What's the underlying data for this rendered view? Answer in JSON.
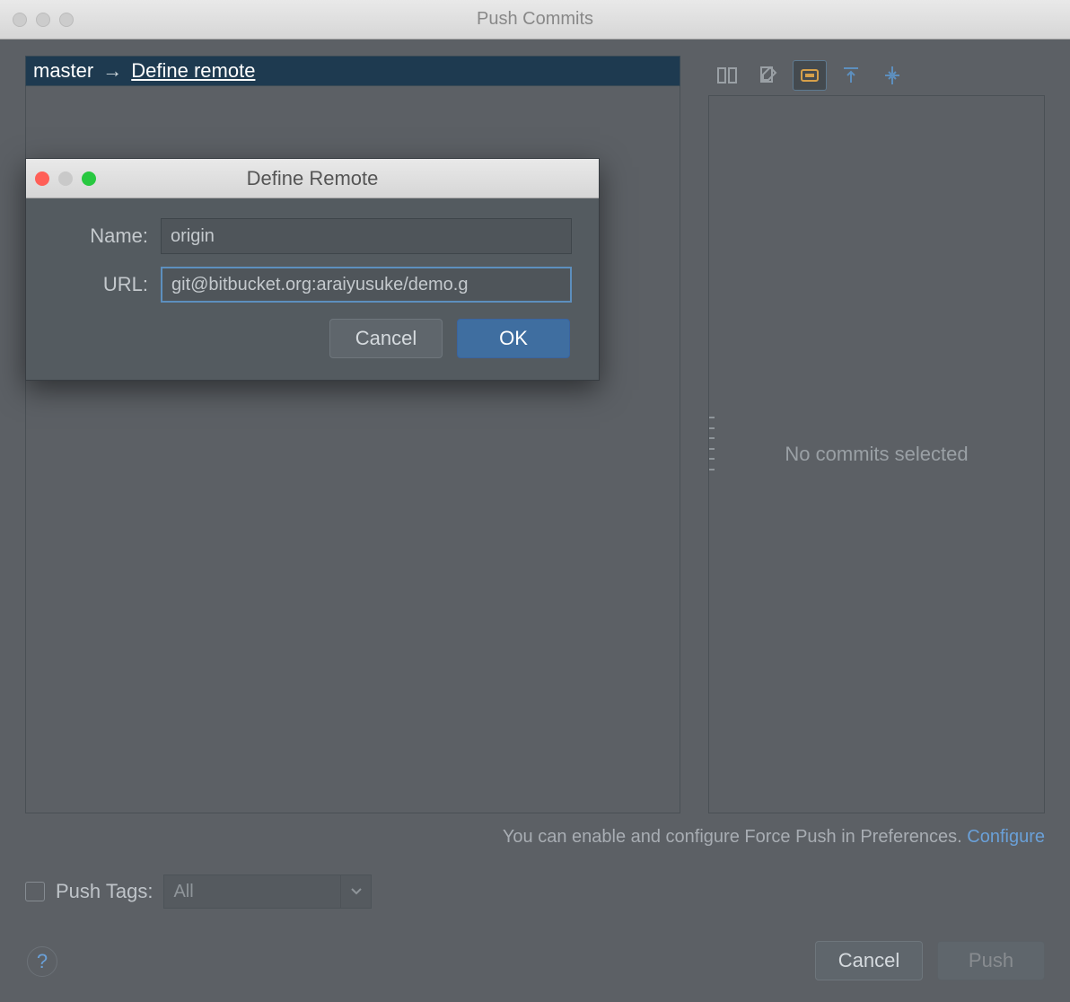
{
  "window": {
    "title": "Push Commits"
  },
  "branch": {
    "name": "master",
    "arrow": "→",
    "define_link": "Define remote"
  },
  "side": {
    "empty_text": "No commits selected"
  },
  "hint": {
    "text": "You can enable and configure Force Push in Preferences. ",
    "configure": "Configure"
  },
  "pushtags": {
    "label": "Push Tags:",
    "select_value": "All"
  },
  "buttons": {
    "cancel": "Cancel",
    "push": "Push"
  },
  "modal": {
    "title": "Define Remote",
    "name_label": "Name:",
    "name_value": "origin",
    "url_label": "URL:",
    "url_value": "git@bitbucket.org:araiyusuke/demo.g",
    "cancel": "Cancel",
    "ok": "OK"
  }
}
